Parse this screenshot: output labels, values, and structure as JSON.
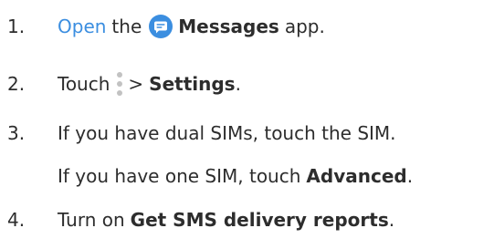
{
  "steps": [
    {
      "number": "1.",
      "parts": {
        "link": "Open",
        "t1": "the",
        "bold": "Messages",
        "t2": "app."
      }
    },
    {
      "number": "2.",
      "parts": {
        "t1": "Touch",
        "t2": ">",
        "bold": "Settings",
        "t3": "."
      }
    },
    {
      "number": "3.",
      "line1": "If you have dual SIMs, touch the SIM.",
      "line2": {
        "t1": "If you have one SIM, touch",
        "bold": "Advanced",
        "t2": "."
      }
    },
    {
      "number": "4.",
      "parts": {
        "t1": "Turn on",
        "bold": "Get SMS delivery reports",
        "t2": "."
      }
    }
  ],
  "colors": {
    "link": "#3b8ee0",
    "text": "#2d2d2d",
    "icon_blue": "#3b8ee0",
    "dots": "#c2c2c2"
  },
  "icons": {
    "messages": "messages-app-icon",
    "more": "more-vert-icon"
  }
}
